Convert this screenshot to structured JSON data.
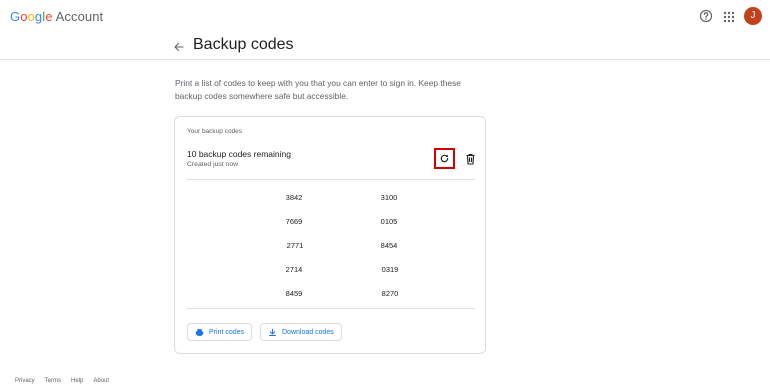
{
  "header": {
    "brand_letters": [
      {
        "ch": "G",
        "color": "#4285F4"
      },
      {
        "ch": "o",
        "color": "#EA4335"
      },
      {
        "ch": "o",
        "color": "#FBBC05"
      },
      {
        "ch": "g",
        "color": "#4285F4"
      },
      {
        "ch": "l",
        "color": "#34A853"
      },
      {
        "ch": "e",
        "color": "#EA4335"
      }
    ],
    "account_label": "Account",
    "avatar_initial": "J",
    "avatar_color": "#c1411b",
    "icons": [
      "help-icon",
      "apps-icon"
    ]
  },
  "page": {
    "title": "Backup codes",
    "description": "Print a list of codes to keep with you that you can enter to sign in. Keep these backup codes somewhere safe but accessible."
  },
  "card": {
    "label": "Your backup codes",
    "remaining": "10 backup codes remaining",
    "created": "Created just now",
    "codes": [
      "3842",
      "3100",
      "7669",
      "0105",
      "2771",
      "8454",
      "2714",
      "0319",
      "8459",
      "8270"
    ],
    "print_label": "Print codes",
    "download_label": "Download codes"
  },
  "footer": {
    "links": [
      "Privacy",
      "Terms",
      "Help",
      "About"
    ]
  },
  "colors": {
    "accent": "#1a73e8",
    "highlight": "#d50000"
  }
}
